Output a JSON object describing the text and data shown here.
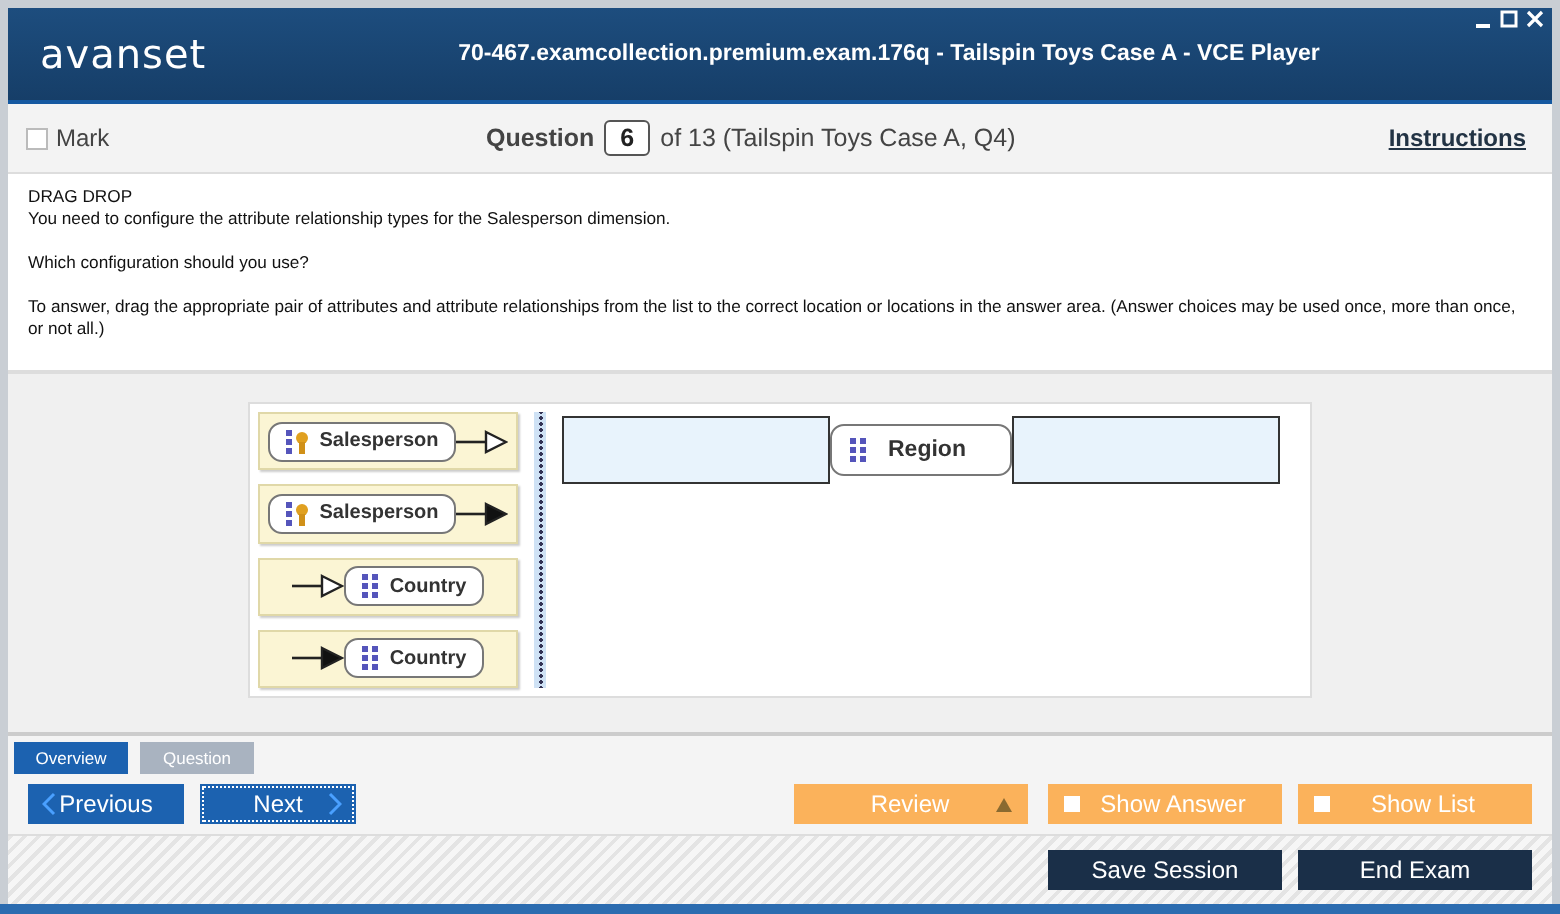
{
  "window": {
    "logo": "avanset",
    "title": "70-467.examcollection.premium.exam.176q - Tailspin Toys Case A - VCE Player"
  },
  "toolbar": {
    "mark": {
      "label": "Mark",
      "checked": false
    },
    "question_label": "Question",
    "question_number": "6",
    "question_of": "of 13 (Tailspin Toys Case A, Q4)",
    "instructions": "Instructions"
  },
  "question": {
    "type": "DRAG DROP",
    "paragraphs": [
      "You need to configure the attribute relationship types for the Salesperson dimension.",
      "Which configuration should you use?",
      "To answer, drag the appropriate pair of attributes and attribute relationships from the list to the correct location or locations in the answer area. (Answer choices may be used once, more than once, or not all.)"
    ]
  },
  "choices": [
    {
      "label": "Salesperson",
      "kind": "key-hollow-right"
    },
    {
      "label": "Salesperson",
      "kind": "key-solid-right"
    },
    {
      "label": "Country",
      "kind": "attribute-hollow-left"
    },
    {
      "label": "Country",
      "kind": "attribute-solid-left"
    }
  ],
  "answer_area": {
    "node": "Region"
  },
  "tabs": [
    {
      "label": "Overview",
      "selected": true
    },
    {
      "label": "Question",
      "selected": false
    }
  ],
  "nav": {
    "previous": "Previous",
    "next": "Next",
    "review": "Review",
    "show_answer": {
      "label": "Show Answer",
      "checked": false
    },
    "show_list": {
      "label": "Show List",
      "checked": false
    }
  },
  "footer": {
    "save": "Save Session",
    "end": "End Exam"
  }
}
